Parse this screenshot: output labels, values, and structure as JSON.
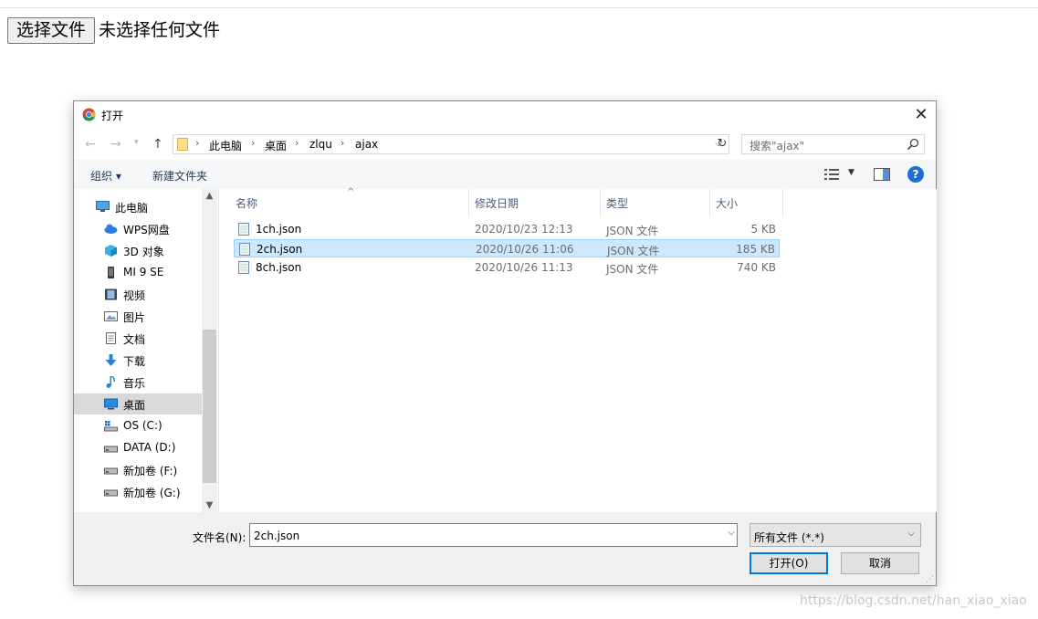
{
  "page": {
    "file_button_label": "选择文件",
    "file_status": "未选择任何文件"
  },
  "dialog": {
    "title": "打开",
    "address": {
      "breadcrumbs": [
        "此电脑",
        "桌面",
        "zlqu",
        "ajax"
      ]
    },
    "search_placeholder": "搜索\"ajax\"",
    "toolbar": {
      "organize_label": "组织 ▾",
      "new_folder_label": "新建文件夹"
    },
    "nav_items": [
      {
        "label": "此电脑",
        "icon": "computer-icon"
      },
      {
        "label": "WPS网盘",
        "icon": "cloud-icon"
      },
      {
        "label": "3D 对象",
        "icon": "cube-icon"
      },
      {
        "label": "MI 9 SE",
        "icon": "phone-icon"
      },
      {
        "label": "视频",
        "icon": "video-icon"
      },
      {
        "label": "图片",
        "icon": "picture-icon"
      },
      {
        "label": "文档",
        "icon": "document-icon"
      },
      {
        "label": "下载",
        "icon": "download-icon"
      },
      {
        "label": "音乐",
        "icon": "music-icon"
      },
      {
        "label": "桌面",
        "icon": "desktop-icon",
        "selected": true
      },
      {
        "label": "OS (C:)",
        "icon": "drive-icon"
      },
      {
        "label": "DATA (D:)",
        "icon": "drive-icon"
      },
      {
        "label": "新加卷 (F:)",
        "icon": "drive-icon"
      },
      {
        "label": "新加卷 (G:)",
        "icon": "drive-icon"
      }
    ],
    "columns": {
      "name": "名称",
      "date": "修改日期",
      "type": "类型",
      "size": "大小"
    },
    "files": [
      {
        "name": "1ch.json",
        "date": "2020/10/23 12:13",
        "type": "JSON 文件",
        "size": "5 KB"
      },
      {
        "name": "2ch.json",
        "date": "2020/10/26 11:06",
        "type": "JSON 文件",
        "size": "185 KB",
        "selected": true
      },
      {
        "name": "8ch.json",
        "date": "2020/10/26 11:13",
        "type": "JSON 文件",
        "size": "740 KB"
      }
    ],
    "filename_label": "文件名(N):",
    "filename_value": "2ch.json",
    "filetype_value": "所有文件 (*.*)",
    "open_label": "打开(O)",
    "cancel_label": "取消"
  },
  "watermark": "https://blog.csdn.net/han_xiao_xiao",
  "colors": {
    "selection_bg": "#cce8ff",
    "selection_border": "#99d1ff",
    "accent": "#0078d7",
    "nav_selected": "#d9d9d9"
  }
}
